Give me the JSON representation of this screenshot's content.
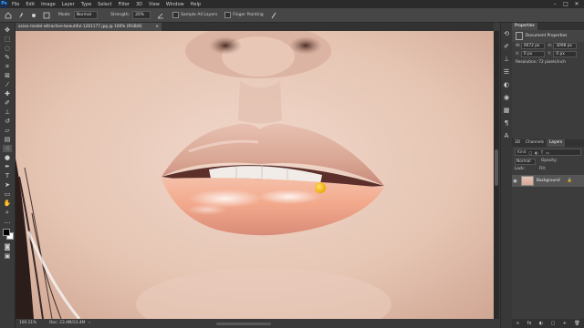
{
  "menu": {
    "logo": "Ps",
    "items": [
      "File",
      "Edit",
      "Image",
      "Layer",
      "Type",
      "Select",
      "Filter",
      "3D",
      "View",
      "Window",
      "Help"
    ],
    "window_controls": [
      "–",
      "□",
      "✕"
    ]
  },
  "options": {
    "mode_label": "Mode:",
    "mode_value": "Normal",
    "strength_label": "Strength:",
    "strength_value": "20%",
    "sample_all_layers": "Sample All Layers",
    "finger_painting": "Finger Painting"
  },
  "document": {
    "tab_title": "asian-model-attractive-beautiful-1261177.jpg @ 100% (RGB/8)",
    "close": "×"
  },
  "status": {
    "zoom": "100.11%",
    "doc_size": "Doc: 23.4M/23.4M"
  },
  "properties": {
    "tab": "Properties",
    "section": "Document Properties",
    "w_label": "W:",
    "w_value": "4672 px",
    "h_label": "H:",
    "h_value": "3098 px",
    "x_label": "X:",
    "x_value": "0 px",
    "y_label": "Y:",
    "y_value": "0 px",
    "resolution": "Resolution: 72 pixels/inch"
  },
  "layers_panel": {
    "tabs": [
      "3D",
      "Channels",
      "Layers"
    ],
    "filter_placeholder": "Kind",
    "blend_mode": "Normal",
    "opacity_label": "Opacity:",
    "lock_label": "Lock:",
    "fill_label": "Fill:",
    "layer_name": "Background",
    "bottom_icons": [
      "fx",
      "◐",
      "▢",
      "+",
      "🗑"
    ]
  },
  "colors": {
    "accent": "#31a8ff",
    "brush_cursor": "#f5b800"
  }
}
